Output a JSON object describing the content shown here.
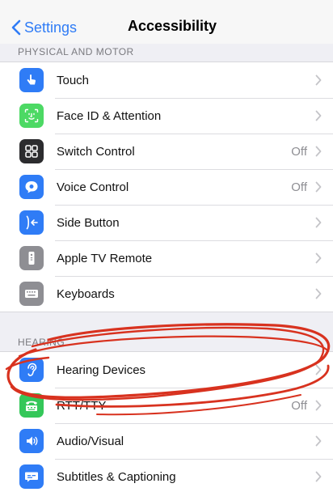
{
  "nav": {
    "back_label": "Settings",
    "title": "Accessibility"
  },
  "sections": {
    "physical_motor": {
      "header": "PHYSICAL AND MOTOR",
      "rows": [
        {
          "label": "Touch",
          "value": "",
          "icon": "hand-pointer-icon",
          "color": "#2f7cf6"
        },
        {
          "label": "Face ID & Attention",
          "value": "",
          "icon": "face-id-icon",
          "color": "#4cd964"
        },
        {
          "label": "Switch Control",
          "value": "Off",
          "icon": "switch-grid-icon",
          "color": "#2c2c2e"
        },
        {
          "label": "Voice Control",
          "value": "Off",
          "icon": "voice-bubble-icon",
          "color": "#2f7cf6"
        },
        {
          "label": "Side Button",
          "value": "",
          "icon": "side-button-icon",
          "color": "#2f7cf6"
        },
        {
          "label": "Apple TV Remote",
          "value": "",
          "icon": "remote-icon",
          "color": "#8e8e93"
        },
        {
          "label": "Keyboards",
          "value": "",
          "icon": "keyboard-icon",
          "color": "#8e8e93"
        }
      ]
    },
    "hearing": {
      "header": "HEARING",
      "rows": [
        {
          "label": "Hearing Devices",
          "value": "",
          "icon": "ear-icon",
          "color": "#2f7cf6"
        },
        {
          "label": "RTT/TTY",
          "value": "Off",
          "icon": "tty-icon",
          "color": "#34c759"
        },
        {
          "label": "Audio/Visual",
          "value": "",
          "icon": "speaker-icon",
          "color": "#2f7cf6"
        },
        {
          "label": "Subtitles & Captioning",
          "value": "",
          "icon": "captions-icon",
          "color": "#2f7cf6"
        }
      ]
    }
  },
  "annotation": {
    "color": "#d8321f",
    "meaning": "hand-drawn circle around Hearing Devices"
  }
}
